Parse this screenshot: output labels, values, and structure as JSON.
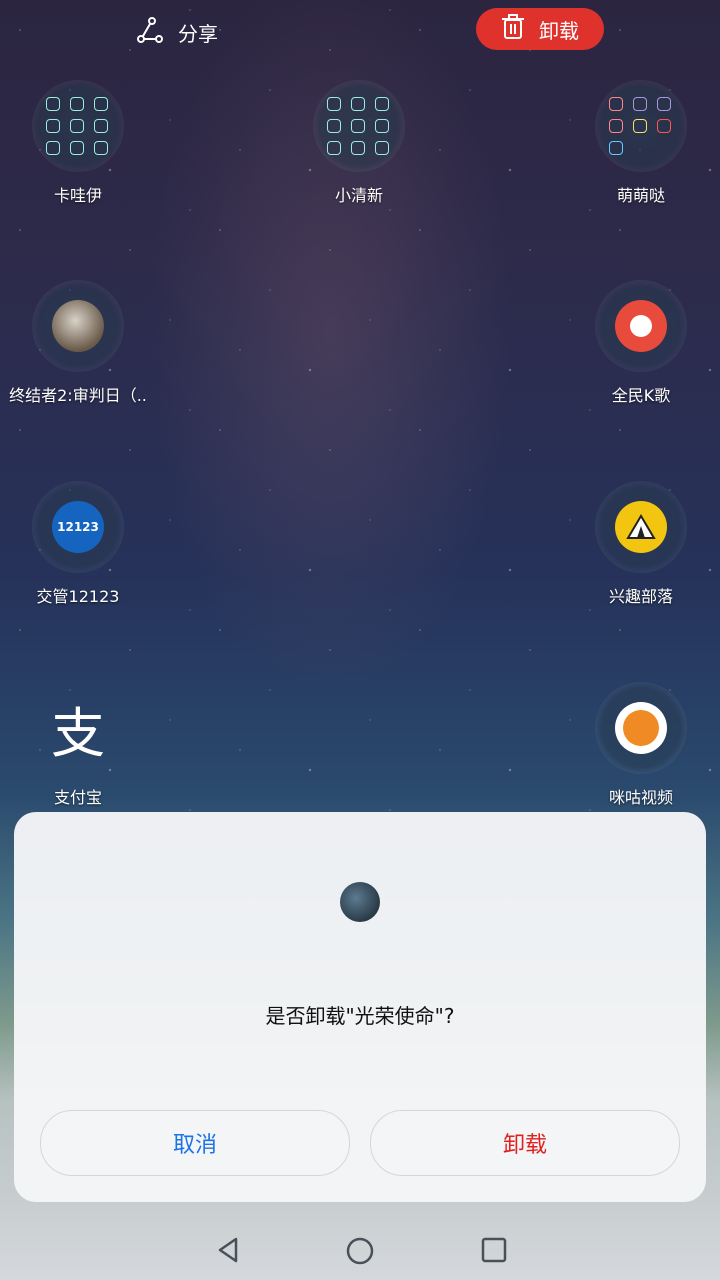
{
  "topbar": {
    "share_label": "分享",
    "uninstall_label": "卸载"
  },
  "apps": [
    {
      "label": "卡哇伊",
      "icon": "folder-icon"
    },
    {
      "label": "小清新",
      "icon": "folder-icon"
    },
    {
      "label": "萌萌哒",
      "icon": "folder-icon"
    },
    {
      "label": "终结者2:审判日（..",
      "icon": "game-avatar-icon"
    },
    {
      "label": "全民K歌",
      "icon": "parrot-icon"
    },
    {
      "label": "交管12123",
      "icon": "traffic-icon",
      "badge": "12123"
    },
    {
      "label": "兴趣部落",
      "icon": "tent-icon"
    },
    {
      "label": "支付宝",
      "icon": "alipay-icon",
      "glyph": "支"
    },
    {
      "label": "咪咕视频",
      "icon": "play-icon"
    }
  ],
  "dialog": {
    "question": "是否卸载\"光荣使命\"?",
    "cancel_label": "取消",
    "confirm_label": "卸载"
  },
  "colors": {
    "accent_red": "#e0322c",
    "cancel_blue": "#1a73e8"
  }
}
